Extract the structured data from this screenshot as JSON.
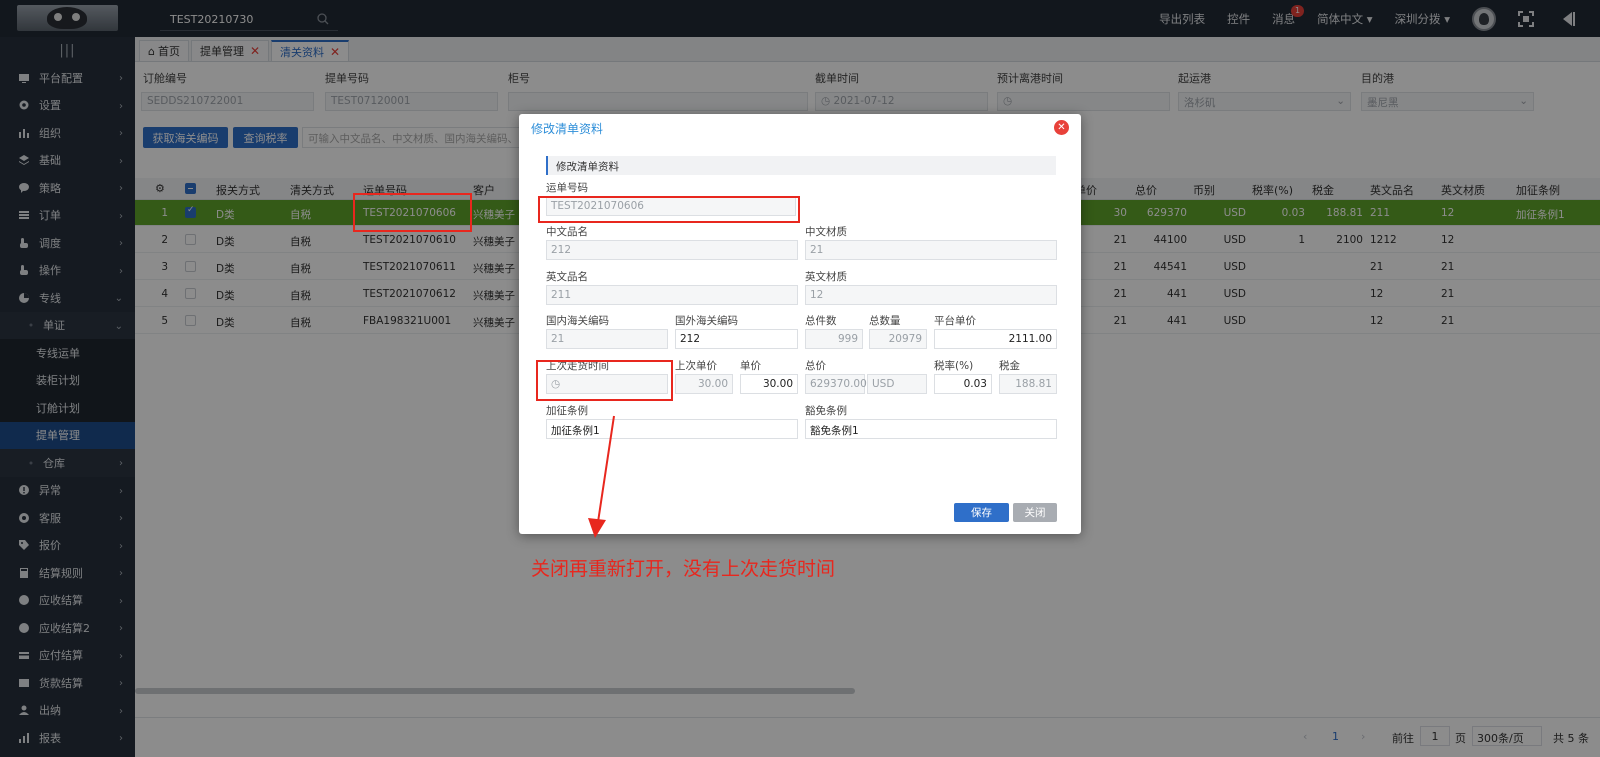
{
  "topbar": {
    "search_value": "TEST20210730",
    "links": [
      "导出列表",
      "控件",
      "消息",
      "简体中文 ▾",
      "深圳分拨 ▾"
    ],
    "message_badge": "1"
  },
  "sidebar": {
    "items": [
      {
        "label": "平台配置",
        "icon": "monitor-icon"
      },
      {
        "label": "设置",
        "icon": "gear-icon"
      },
      {
        "label": "组织",
        "icon": "org-icon"
      },
      {
        "label": "基础",
        "icon": "layers-icon"
      },
      {
        "label": "策略",
        "icon": "bubble-icon"
      },
      {
        "label": "订单",
        "icon": "list-icon"
      },
      {
        "label": "调度",
        "icon": "hand-icon"
      },
      {
        "label": "操作",
        "icon": "hand-icon"
      },
      {
        "label": "专线",
        "icon": "pie-icon"
      },
      {
        "label": "单证",
        "icon": "dot-icon"
      },
      {
        "label": "专线运单",
        "icon": ""
      },
      {
        "label": "装柜计划",
        "icon": ""
      },
      {
        "label": "订舱计划",
        "icon": ""
      },
      {
        "label": "提单管理",
        "icon": ""
      },
      {
        "label": "仓库",
        "icon": "dot-icon"
      },
      {
        "label": "异常",
        "icon": "alert-icon"
      },
      {
        "label": "客服",
        "icon": "gauge-icon"
      },
      {
        "label": "报价",
        "icon": "tag-icon"
      },
      {
        "label": "结算规则",
        "icon": "calc-icon"
      },
      {
        "label": "应收结算",
        "icon": "coin-icon"
      },
      {
        "label": "应收结算2",
        "icon": "coin-icon"
      },
      {
        "label": "应付结算",
        "icon": "card-icon"
      },
      {
        "label": "货款结算",
        "icon": "coin-icon"
      },
      {
        "label": "出纳",
        "icon": "user-icon"
      },
      {
        "label": "报表",
        "icon": "chart-icon"
      }
    ]
  },
  "tabs": [
    {
      "label": "首页"
    },
    {
      "label": "提单管理"
    },
    {
      "label": "清关资料"
    }
  ],
  "filters": {
    "labels": [
      "订舱编号",
      "提单号码",
      "柜号",
      "截单时间",
      "预计离港时间",
      "起运港",
      "目的港"
    ],
    "values": [
      "SEDDS210722001",
      "TEST07120001",
      "",
      "2021-07-12",
      "",
      "洛杉矶",
      "墨尼黑"
    ],
    "btn_customs": "获取海关编码",
    "btn_tax": "查询税率",
    "hint": "可输入中文品名、中文材质、国内海关编码、"
  },
  "table": {
    "headers": [
      "报关方式",
      "清关方式",
      "运单号码",
      "客户",
      "单价",
      "总价",
      "币别",
      "税率(%)",
      "税金",
      "英文品名",
      "英文材质",
      "加征条例"
    ],
    "rows": [
      {
        "no": "1",
        "decl": "D类",
        "clear": "自税",
        "waybill": "TEST2021070606",
        "cust": "兴穗美子",
        "left": "30",
        "price": "30",
        "total": "629370",
        "cur": "USD",
        "rate": "0.03",
        "tax": "188.81",
        "en_name": "211",
        "en_mat": "12",
        "extra": "加征条例1",
        "selected": true
      },
      {
        "no": "2",
        "decl": "D类",
        "clear": "自税",
        "waybill": "TEST2021070610",
        "cust": "兴穗美子",
        "left": "21",
        "price": "21",
        "total": "44100",
        "cur": "USD",
        "rate": "1",
        "tax": "2100",
        "en_name": "1212",
        "en_mat": "12",
        "extra": "",
        "selected": false
      },
      {
        "no": "3",
        "decl": "D类",
        "clear": "自税",
        "waybill": "TEST2021070611",
        "cust": "兴穗美子",
        "left": "21",
        "price": "21",
        "total": "44541",
        "cur": "USD",
        "rate": "",
        "tax": "",
        "en_name": "21",
        "en_mat": "21",
        "extra": "",
        "selected": false
      },
      {
        "no": "4",
        "decl": "D类",
        "clear": "自税",
        "waybill": "TEST2021070612",
        "cust": "兴穗美子",
        "left": "",
        "price": "21",
        "total": "441",
        "cur": "USD",
        "rate": "",
        "tax": "",
        "en_name": "12",
        "en_mat": "21",
        "extra": "",
        "selected": false
      },
      {
        "no": "5",
        "decl": "D类",
        "clear": "自税",
        "waybill": "FBA198321U001",
        "cust": "兴穗美子",
        "left": "21",
        "price": "21",
        "total": "441",
        "cur": "USD",
        "rate": "",
        "tax": "",
        "en_name": "12",
        "en_mat": "21",
        "extra": "",
        "selected": false
      }
    ]
  },
  "pager": {
    "page": "1",
    "goto_label": "前往",
    "goto_value": "1",
    "page_unit": "页",
    "page_size": "300条/页",
    "total": "共 5 条"
  },
  "modal": {
    "title": "修改清单资料",
    "section": "修改清单资料",
    "waybill_label": "运单号码",
    "waybill_value": "TEST2021070606",
    "cn_name_label": "中文品名",
    "cn_name_value": "212",
    "cn_mat_label": "中文材质",
    "cn_mat_value": "21",
    "en_name_label": "英文品名",
    "en_name_value": "211",
    "en_mat_label": "英文材质",
    "en_mat_value": "12",
    "dom_code_label": "国内海关编码",
    "dom_code_value": "21",
    "for_code_label": "国外海关编码",
    "for_code_value": "212",
    "pieces_label": "总件数",
    "pieces_value": "999",
    "qty_label": "总数量",
    "qty_value": "20979",
    "plat_price_label": "平台单价",
    "plat_price_value": "2111.00",
    "last_time_label": "上次走货时间",
    "last_price_label": "上次单价",
    "last_price_value": "30.00",
    "price_label": "单价",
    "price_value": "30.00",
    "total_label": "总价",
    "total_value": "629370.00",
    "currency_value": "USD",
    "rate_label": "税率(%)",
    "rate_value": "0.03",
    "tax_label": "税金",
    "tax_value": "188.81",
    "extra_label": "加征条例",
    "extra_value": "加征条例1",
    "exempt_label": "豁免条例",
    "exempt_value": "豁免条例1",
    "save": "保存",
    "close": "关闭"
  },
  "annotation": "关闭再重新打开，没有上次走货时间",
  "colors": {
    "accent": "#2f6fc9",
    "selected_row": "#5fa52a",
    "annotation": "#e8271e"
  }
}
